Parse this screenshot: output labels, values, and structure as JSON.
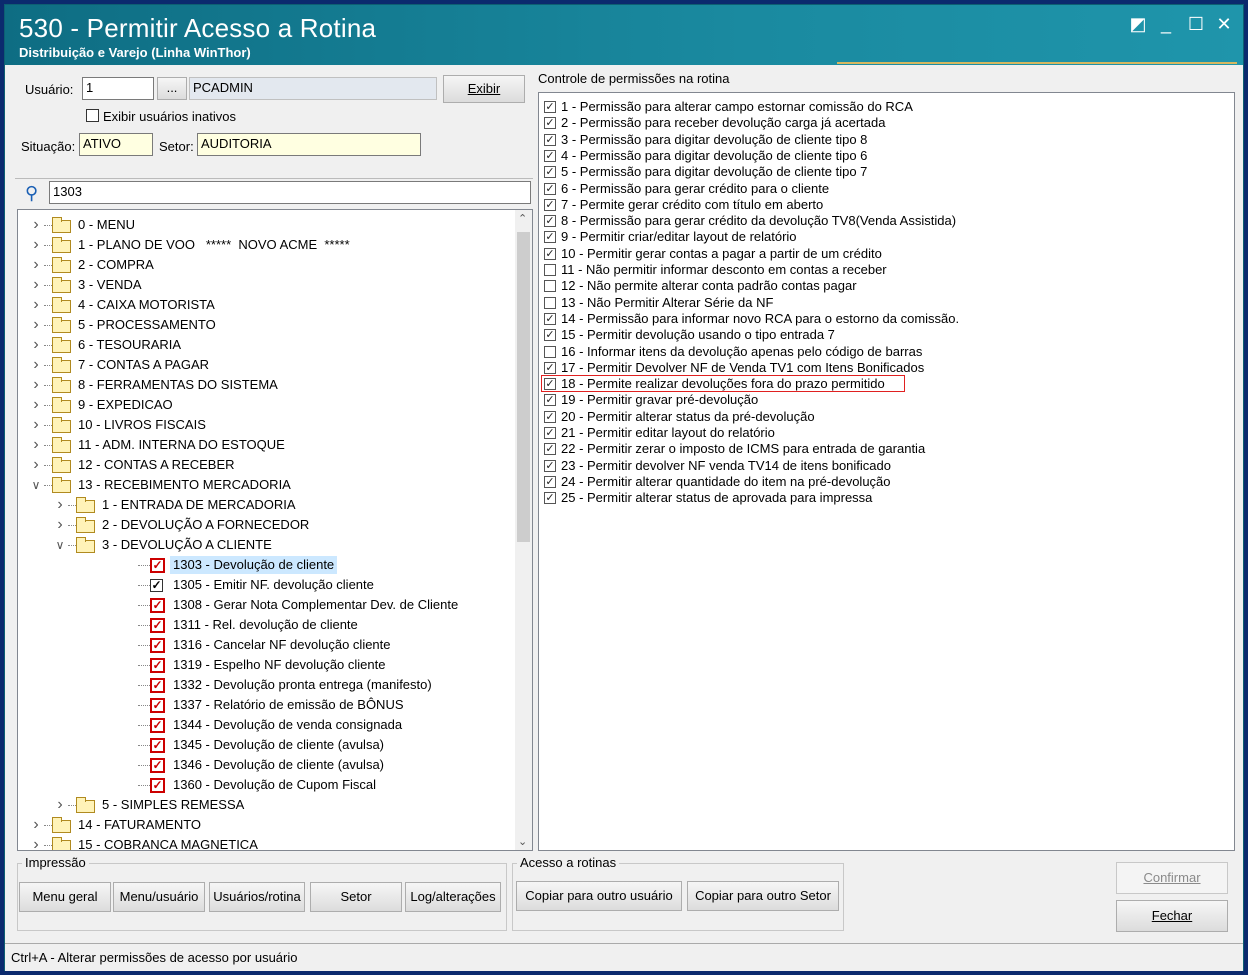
{
  "window": {
    "title": "530 - Permitir Acesso a Rotina",
    "subtitle": "Distribuição e Varejo (Linha WinThor)",
    "controls": [
      "◩",
      "_",
      "☐",
      "✕"
    ]
  },
  "user": {
    "label_usuario": "Usuário:",
    "code": "1",
    "browse_label": "...",
    "name": "PCADMIN",
    "exibir_label": "Exibir",
    "inactive_label": "Exibir usuários inativos",
    "situacao_label": "Situação:",
    "situacao": "ATIVO",
    "setor_label": "Setor:",
    "setor": "AUDITORIA"
  },
  "search": {
    "value": "1303"
  },
  "tree": [
    {
      "label": "0 - MENU",
      "level": 0,
      "expander": ">",
      "kind": "folder"
    },
    {
      "label": "1 - PLANO DE VOO   *****  NOVO ACME  *****",
      "level": 0,
      "expander": ">",
      "kind": "folder"
    },
    {
      "label": "2 - COMPRA",
      "level": 0,
      "expander": ">",
      "kind": "folder"
    },
    {
      "label": "3 - VENDA",
      "level": 0,
      "expander": ">",
      "kind": "folder"
    },
    {
      "label": "4 - CAIXA MOTORISTA",
      "level": 0,
      "expander": ">",
      "kind": "folder"
    },
    {
      "label": "5 - PROCESSAMENTO",
      "level": 0,
      "expander": ">",
      "kind": "folder"
    },
    {
      "label": "6 - TESOURARIA",
      "level": 0,
      "expander": ">",
      "kind": "folder"
    },
    {
      "label": "7 - CONTAS A PAGAR",
      "level": 0,
      "expander": ">",
      "kind": "folder"
    },
    {
      "label": "8 - FERRAMENTAS DO SISTEMA",
      "level": 0,
      "expander": ">",
      "kind": "folder"
    },
    {
      "label": "9 - EXPEDICAO",
      "level": 0,
      "expander": ">",
      "kind": "folder"
    },
    {
      "label": "10 - LIVROS FISCAIS",
      "level": 0,
      "expander": ">",
      "kind": "folder"
    },
    {
      "label": "11 - ADM. INTERNA DO ESTOQUE",
      "level": 0,
      "expander": ">",
      "kind": "folder"
    },
    {
      "label": "12 - CONTAS A RECEBER",
      "level": 0,
      "expander": ">",
      "kind": "folder"
    },
    {
      "label": "13 - RECEBIMENTO MERCADORIA",
      "level": 0,
      "expander": "v",
      "kind": "folder"
    },
    {
      "label": "1 - ENTRADA DE MERCADORIA",
      "level": 1,
      "expander": ">",
      "kind": "folder"
    },
    {
      "label": "2 - DEVOLUÇÃO A FORNECEDOR",
      "level": 1,
      "expander": ">",
      "kind": "folder"
    },
    {
      "label": "3 - DEVOLUÇÃO A CLIENTE",
      "level": 1,
      "expander": "v",
      "kind": "folder"
    },
    {
      "label": "1303 - Devolução de cliente",
      "level": 2,
      "kind": "check",
      "red": true,
      "selected": true
    },
    {
      "label": "1305 - Emitir NF. devolução cliente",
      "level": 2,
      "kind": "check",
      "red": false
    },
    {
      "label": "1308 - Gerar Nota Complementar Dev. de Cliente",
      "level": 2,
      "kind": "check",
      "red": true
    },
    {
      "label": "1311 - Rel. devolução de cliente",
      "level": 2,
      "kind": "check",
      "red": true
    },
    {
      "label": "1316 - Cancelar NF devolução cliente",
      "level": 2,
      "kind": "check",
      "red": true
    },
    {
      "label": "1319 - Espelho NF devolução cliente",
      "level": 2,
      "kind": "check",
      "red": true
    },
    {
      "label": "1332 - Devolução pronta entrega (manifesto)",
      "level": 2,
      "kind": "check",
      "red": true
    },
    {
      "label": "1337 - Relatório de emissão de BÔNUS",
      "level": 2,
      "kind": "check",
      "red": true
    },
    {
      "label": "1344 - Devolução de venda consignada",
      "level": 2,
      "kind": "check",
      "red": true
    },
    {
      "label": "1345 - Devolução de cliente (avulsa)",
      "level": 2,
      "kind": "check",
      "red": true
    },
    {
      "label": "1346 - Devolução de cliente (avulsa)",
      "level": 2,
      "kind": "check",
      "red": true
    },
    {
      "label": "1360 - Devolução de Cupom Fiscal",
      "level": 2,
      "kind": "check",
      "red": true
    },
    {
      "label": "5 - SIMPLES REMESSA",
      "level": 1,
      "expander": ">",
      "kind": "folder"
    },
    {
      "label": "14 - FATURAMENTO",
      "level": 0,
      "expander": ">",
      "kind": "folder"
    },
    {
      "label": "15 - COBRANCA MAGNETICA",
      "level": 0,
      "expander": ">",
      "kind": "folder"
    }
  ],
  "permissions": {
    "header": "Controle de permissões na rotina",
    "items": [
      {
        "label": "1 - Permissão para alterar campo estornar comissão do RCA",
        "checked": true
      },
      {
        "label": "2 - Permissão para receber devolução carga já acertada",
        "checked": true
      },
      {
        "label": "3 - Permissão para digitar devolução de cliente tipo 8",
        "checked": true
      },
      {
        "label": "4 - Permissão para digitar devolução de cliente tipo 6",
        "checked": true
      },
      {
        "label": "5 - Permissão para digitar devolução de cliente tipo 7",
        "checked": true
      },
      {
        "label": "6 - Permissão para gerar crédito para o cliente",
        "checked": true
      },
      {
        "label": "7 - Permite gerar crédito com título em aberto",
        "checked": true
      },
      {
        "label": "8 - Permissão para gerar crédito da devolução TV8(Venda Assistida)",
        "checked": true
      },
      {
        "label": "9 - Permitir criar/editar layout de relatório",
        "checked": true
      },
      {
        "label": "10 - Permitir gerar contas a pagar a partir de um crédito",
        "checked": true
      },
      {
        "label": "11 - Não permitir informar desconto em contas a receber",
        "checked": false
      },
      {
        "label": "12 - Não permite alterar conta padrão contas pagar",
        "checked": false
      },
      {
        "label": "13 - Não Permitir Alterar Série da NF",
        "checked": false
      },
      {
        "label": "14 - Permissão para informar novo RCA para o estorno da comissão.",
        "checked": true
      },
      {
        "label": "15 - Permitir devolução usando o tipo entrada 7",
        "checked": true
      },
      {
        "label": "16 - Informar itens da devolução apenas pelo código de barras",
        "checked": false
      },
      {
        "label": "17 - Permitir Devolver NF de Venda TV1 com Itens Bonificados",
        "checked": true
      },
      {
        "label": "18 - Permite realizar devoluções fora do prazo permitido",
        "checked": true,
        "highlight": true
      },
      {
        "label": "19 - Permitir gravar pré-devolução",
        "checked": true
      },
      {
        "label": "20 - Permitir alterar status da pré-devolução",
        "checked": true
      },
      {
        "label": "21 - Permitir editar layout do relatório",
        "checked": true
      },
      {
        "label": "22 - Permitir zerar o imposto de ICMS para entrada de garantia",
        "checked": true
      },
      {
        "label": "23 - Permitir devolver NF venda TV14 de itens bonificado",
        "checked": true
      },
      {
        "label": "24 - Permitir alterar quantidade do item na pré-devolução",
        "checked": true
      },
      {
        "label": "25 - Permitir alterar status de aprovada para impressa",
        "checked": true
      }
    ]
  },
  "impressao": {
    "label": "Impressão",
    "buttons": [
      "Menu geral",
      "Menu/usuário",
      "Usuários/rotina",
      "Setor",
      "Log/alterações"
    ]
  },
  "acesso": {
    "label": "Acesso a rotinas",
    "buttons": [
      "Copiar para outro usuário",
      "Copiar para outro Setor"
    ]
  },
  "actions": {
    "confirmar": "Confirmar",
    "fechar": "Fechar"
  },
  "status": "Ctrl+A - Alterar permissões de acesso por usuário",
  "colors": {
    "title_bar": "#0e6d83",
    "highlight_box": "#e02020",
    "selection": "#cce8ff"
  }
}
